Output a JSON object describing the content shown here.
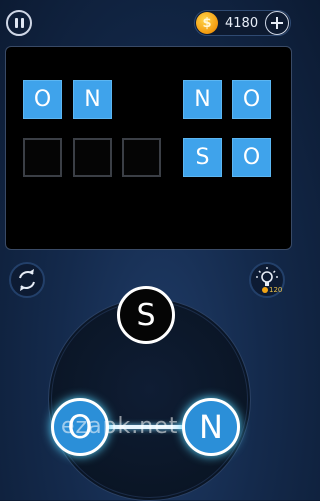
{
  "header": {
    "coins": "4180",
    "coin_symbol": "$"
  },
  "board": {
    "words": [
      {
        "letters": [
          "O",
          "N"
        ],
        "solved": true
      },
      {
        "letters": [
          "",
          "",
          ""
        ],
        "solved": false
      },
      {
        "letters": [
          "N",
          "O"
        ],
        "solved": true
      },
      {
        "letters": [
          "S",
          "O"
        ],
        "solved": true
      }
    ]
  },
  "hint": {
    "cost": "120"
  },
  "wheel": {
    "letters": [
      "S",
      "O",
      "N"
    ],
    "selected": [
      "O",
      "N"
    ]
  },
  "watermark": "ezapk.net",
  "colors": {
    "background": "#142a4c",
    "tile_filled": "#3fa3eb",
    "selected_letter": "#2b8fd8",
    "coin": "#f39a0f"
  }
}
